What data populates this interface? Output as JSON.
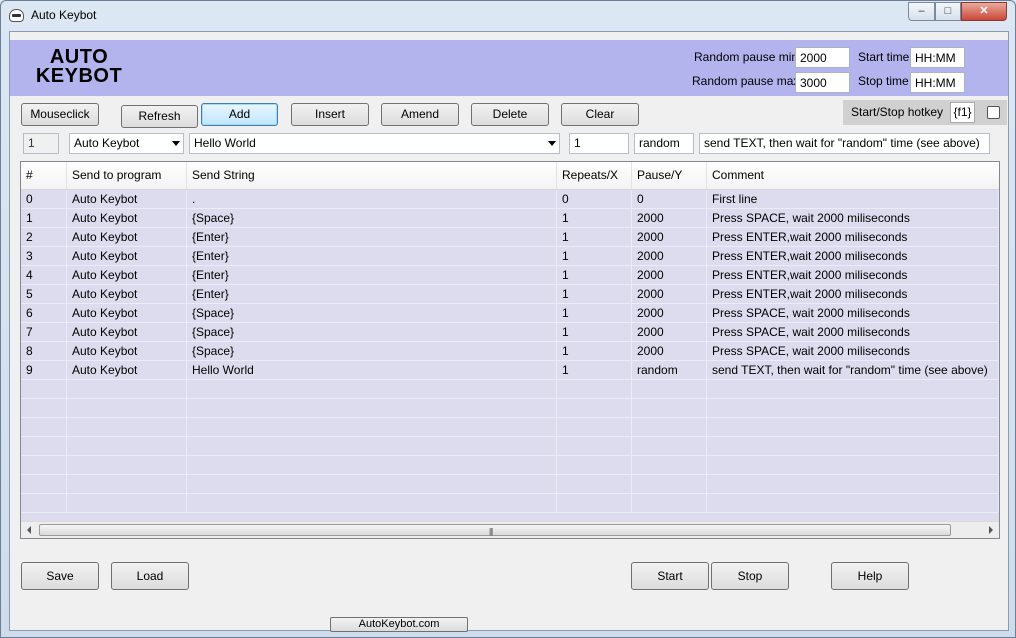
{
  "window": {
    "title": "Auto Keybot",
    "min": "–",
    "max": "□",
    "close": "✕"
  },
  "header": {
    "logo_line1": "AUTO",
    "logo_line2": "KEYBOT",
    "pause_min_label": "Random pause min",
    "pause_min_value": "2000",
    "pause_max_label": "Random pause max",
    "pause_max_value": "3000",
    "start_time_label": "Start time",
    "start_time_value": "HH:MM",
    "stop_time_label": "Stop time",
    "stop_time_value": "HH:MM"
  },
  "toolbar": {
    "mouseclick": "Mouseclick",
    "refresh": "Refresh",
    "add": "Add",
    "insert": "Insert",
    "amend": "Amend",
    "delete": "Delete",
    "clear": "Clear",
    "hotkey_label": "Start/Stop hotkey",
    "hotkey_value": "{f1}"
  },
  "edit_row": {
    "index": "1",
    "program": "Auto Keybot",
    "send_string": "Hello World",
    "repeats": "1",
    "pause": "random",
    "comment": "send TEXT, then wait for \"random\" time (see above)"
  },
  "grid": {
    "columns": [
      "#",
      "Send to program",
      "Send String",
      "Repeats/X",
      "Pause/Y",
      "Comment"
    ],
    "rows": [
      [
        "0",
        "Auto Keybot",
        ".",
        "0",
        "0",
        "First line"
      ],
      [
        "1",
        "Auto Keybot",
        "{Space}",
        "1",
        "2000",
        "Press SPACE, wait 2000 miliseconds"
      ],
      [
        "2",
        "Auto Keybot",
        "{Enter}",
        "1",
        "2000",
        "Press ENTER,wait 2000 miliseconds"
      ],
      [
        "3",
        "Auto Keybot",
        "{Enter}",
        "1",
        "2000",
        "Press ENTER,wait 2000 miliseconds"
      ],
      [
        "4",
        "Auto Keybot",
        "{Enter}",
        "1",
        "2000",
        "Press ENTER,wait 2000 miliseconds"
      ],
      [
        "5",
        "Auto Keybot",
        "{Enter}",
        "1",
        "2000",
        "Press ENTER,wait 2000 miliseconds"
      ],
      [
        "6",
        "Auto Keybot",
        "{Space}",
        "1",
        "2000",
        "Press SPACE, wait 2000 miliseconds"
      ],
      [
        "7",
        "Auto Keybot",
        "{Space}",
        "1",
        "2000",
        "Press SPACE, wait 2000 miliseconds"
      ],
      [
        "8",
        "Auto Keybot",
        "{Space}",
        "1",
        "2000",
        "Press SPACE, wait 2000 miliseconds"
      ],
      [
        "9",
        "Auto Keybot",
        "Hello World",
        "1",
        "random",
        "send TEXT, then wait for \"random\" time (see above)"
      ]
    ],
    "scroll_grip": "|||"
  },
  "bottom": {
    "save": "Save",
    "load": "Load",
    "start": "Start",
    "stop": "Stop",
    "help": "Help",
    "link": "AutoKeybot.com"
  }
}
